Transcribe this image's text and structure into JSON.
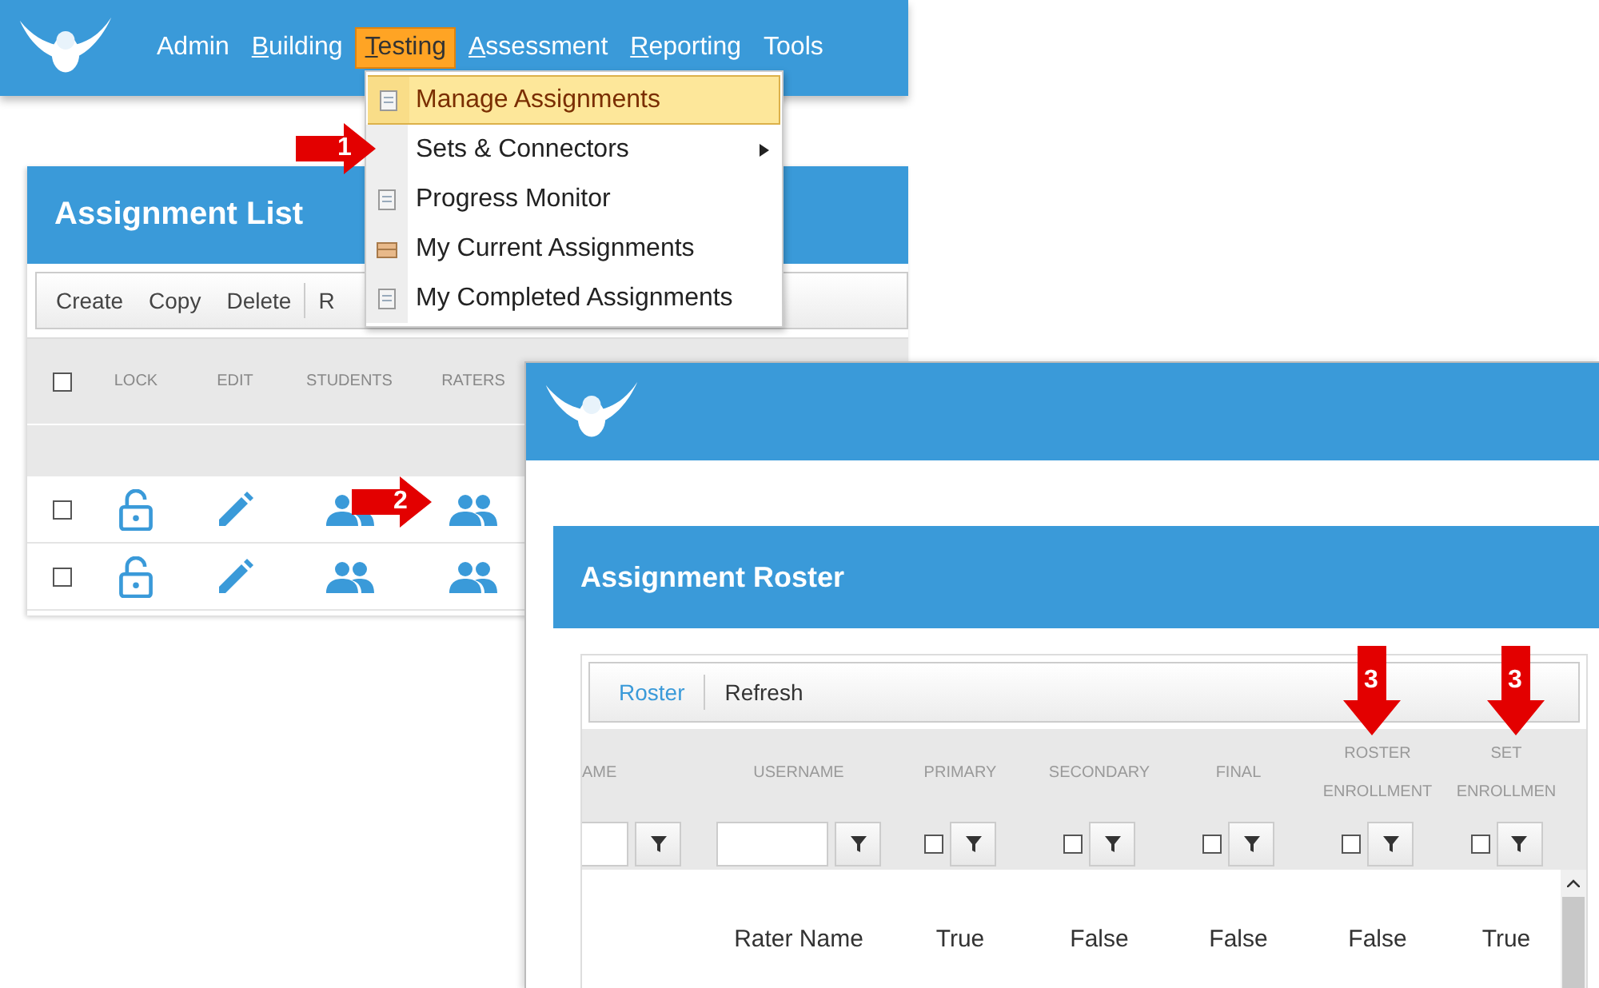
{
  "main_window": {
    "nav": [
      {
        "label": "Admin",
        "mnemonic": false,
        "selected": false
      },
      {
        "label": "Building",
        "mnemonic": true,
        "selected": false
      },
      {
        "label": "Testing",
        "mnemonic": true,
        "selected": true
      },
      {
        "label": "Assessment",
        "mnemonic": true,
        "selected": false
      },
      {
        "label": "Reporting",
        "mnemonic": true,
        "selected": false
      },
      {
        "label": "Tools",
        "mnemonic": false,
        "selected": false
      }
    ],
    "testing_menu": [
      {
        "label": "Manage Assignments",
        "icon": true,
        "submenu": false,
        "selected": true
      },
      {
        "label": "Sets & Connectors",
        "icon": false,
        "submenu": true,
        "selected": false
      },
      {
        "label": "Progress Monitor",
        "icon": true,
        "submenu": false,
        "selected": false
      },
      {
        "label": "My Current Assignments",
        "icon": true,
        "submenu": false,
        "selected": false
      },
      {
        "label": "My Completed Assignments",
        "icon": true,
        "submenu": false,
        "selected": false
      }
    ],
    "assignment_list": {
      "title": "Assignment List",
      "toolbar": [
        "Create",
        "Copy",
        "Delete",
        "R"
      ],
      "select_all": {
        "checked": false
      },
      "columns": [
        "LOCK",
        "EDIT",
        "STUDENTS",
        "RATERS"
      ],
      "rows": [
        {
          "checked": false
        },
        {
          "checked": false
        }
      ]
    }
  },
  "roster_window": {
    "title": "Assignment Roster",
    "toolbar": [
      {
        "label": "Roster",
        "selected": true
      },
      {
        "label": "Refresh",
        "selected": false
      }
    ],
    "columns": [
      {
        "label": "AME",
        "kind": "text"
      },
      {
        "label": "USERNAME",
        "kind": "text"
      },
      {
        "label": "PRIMARY",
        "kind": "check",
        "checked": false
      },
      {
        "label": "SECONDARY",
        "kind": "check",
        "checked": false
      },
      {
        "label": "FINAL",
        "kind": "check",
        "checked": false
      },
      {
        "label": "ROSTER ENROLLMENT",
        "kind": "check",
        "checked": false
      },
      {
        "label": "SET ENROLLMEN",
        "kind": "check",
        "checked": false
      }
    ],
    "rows": [
      {
        "cells": [
          "",
          "Rater Name",
          "True",
          "False",
          "False",
          "False",
          "True"
        ]
      }
    ]
  },
  "annotations": [
    {
      "label": "1",
      "kind": "right"
    },
    {
      "label": "2",
      "kind": "right"
    },
    {
      "label": "3",
      "kind": "down"
    },
    {
      "label": "3",
      "kind": "down"
    }
  ]
}
